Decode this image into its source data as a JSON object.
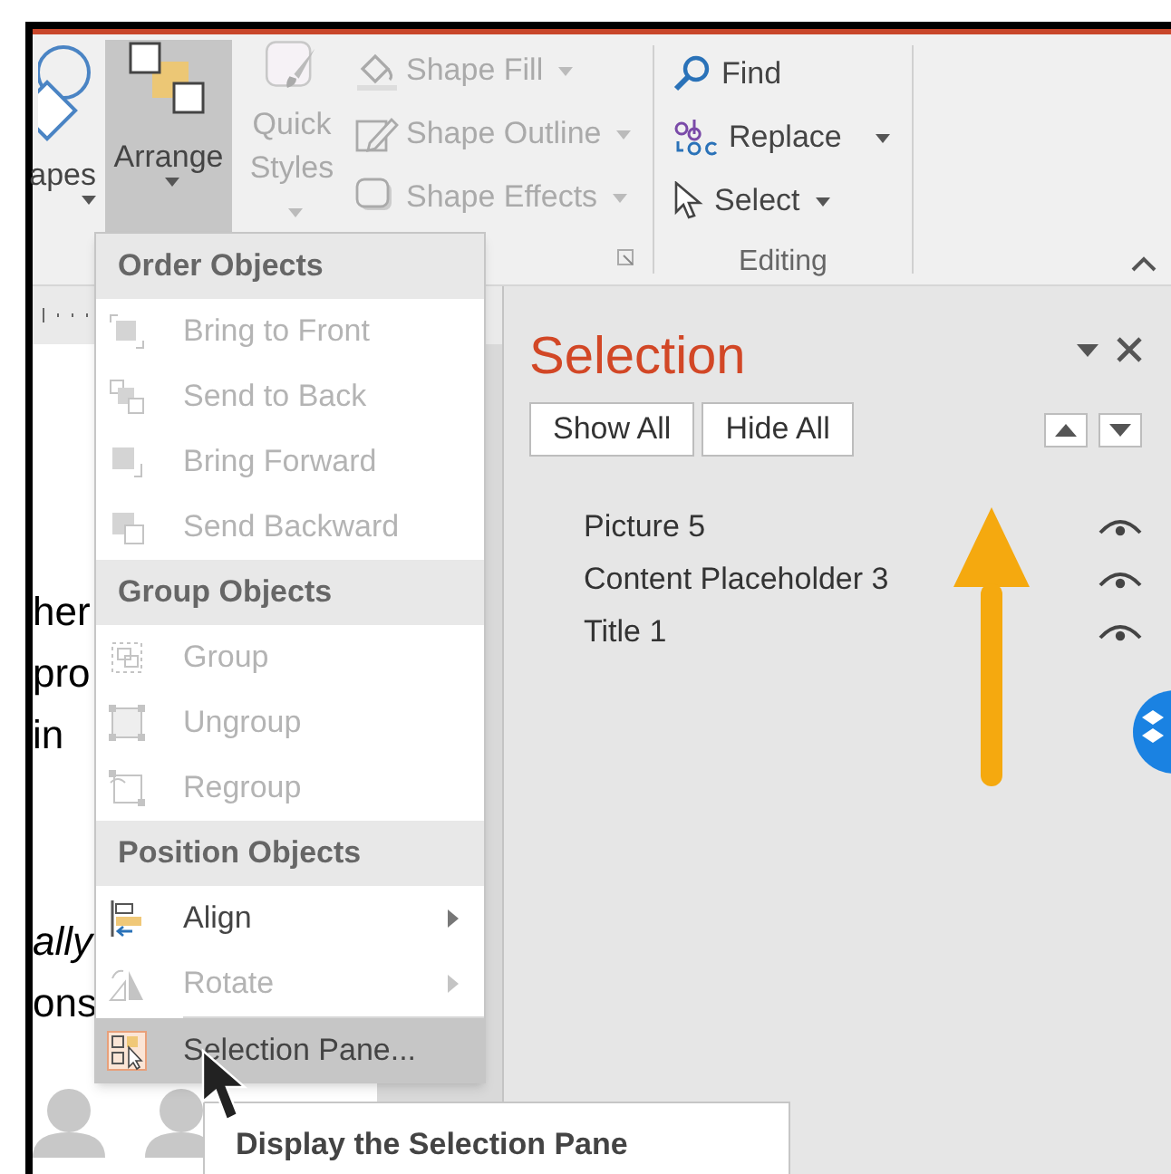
{
  "ribbon": {
    "large_buttons": [
      {
        "label": "apes",
        "selected": false,
        "disabled": false
      },
      {
        "label": "Arrange",
        "selected": true,
        "disabled": false
      },
      {
        "label": "Quick Styles",
        "selected": false,
        "disabled": true
      }
    ],
    "shape_commands": [
      {
        "label": "Shape Fill",
        "disabled": true
      },
      {
        "label": "Shape Outline",
        "disabled": true
      },
      {
        "label": "Shape Effects",
        "disabled": true
      }
    ],
    "editing": {
      "commands": [
        {
          "label": "Find",
          "dropdown": false
        },
        {
          "label": "Replace",
          "dropdown": true
        },
        {
          "label": "Select",
          "dropdown": true
        }
      ],
      "group_label": "Editing"
    }
  },
  "slide_text": [
    {
      "text": "her",
      "italic": false
    },
    {
      "text": "pro",
      "italic": false
    },
    {
      "text": "in",
      "italic": false
    },
    {
      "text": "ally",
      "italic": true
    },
    {
      "text": "ons",
      "italic": false
    }
  ],
  "menu": {
    "sections": [
      {
        "heading": "Order Objects",
        "items": [
          {
            "label": "Bring to Front",
            "disabled": true,
            "submenu": false,
            "selected": false
          },
          {
            "label": "Send to Back",
            "disabled": true,
            "submenu": false,
            "selected": false
          },
          {
            "label": "Bring Forward",
            "disabled": true,
            "submenu": false,
            "selected": false
          },
          {
            "label": "Send Backward",
            "disabled": true,
            "submenu": false,
            "selected": false
          }
        ]
      },
      {
        "heading": "Group Objects",
        "items": [
          {
            "label": "Group",
            "disabled": true,
            "submenu": false,
            "selected": false
          },
          {
            "label": "Ungroup",
            "disabled": true,
            "submenu": false,
            "selected": false
          },
          {
            "label": "Regroup",
            "disabled": true,
            "submenu": false,
            "selected": false
          }
        ]
      },
      {
        "heading": "Position Objects",
        "items": [
          {
            "label": "Align",
            "disabled": false,
            "submenu": true,
            "selected": false
          },
          {
            "label": "Rotate",
            "disabled": true,
            "submenu": true,
            "selected": false
          },
          {
            "label": "Selection Pane...",
            "disabled": false,
            "submenu": false,
            "selected": true
          }
        ]
      }
    ]
  },
  "tooltip": {
    "text": "Display the Selection Pane"
  },
  "selection_pane": {
    "title": "Selection",
    "buttons": [
      "Show All",
      "Hide All"
    ],
    "items": [
      {
        "name": "Picture 5",
        "visible": true
      },
      {
        "name": "Content Placeholder 3",
        "visible": true
      },
      {
        "name": "Title 1",
        "visible": true
      }
    ]
  }
}
